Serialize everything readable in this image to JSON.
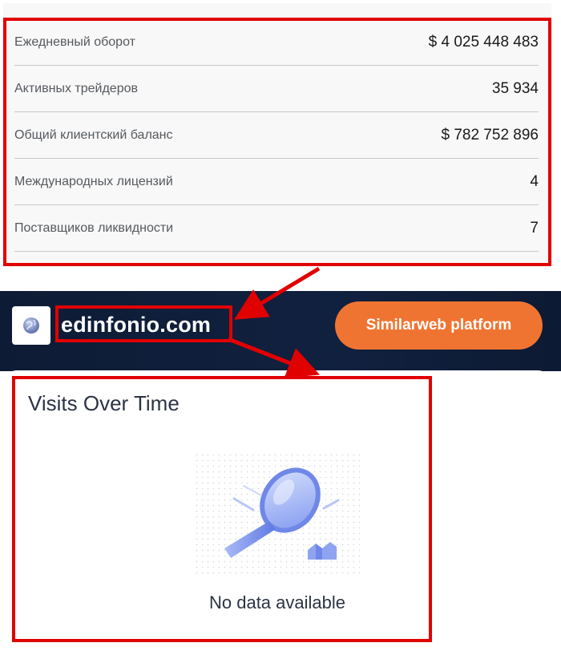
{
  "stats": [
    {
      "label": "Ежедневный оборот",
      "value": "$ 4 025 448 483"
    },
    {
      "label": "Активных трейдеров",
      "value": "35 934"
    },
    {
      "label": "Общий клиентский баланс",
      "value": "$ 782 752 896"
    },
    {
      "label": "Международных лицензий",
      "value": "4"
    },
    {
      "label": "Поставщиков ликвидности",
      "value": "7"
    }
  ],
  "header": {
    "domain": "edinfonio.com",
    "platform_button": "Similarweb platform",
    "site_icon": "globe-icon"
  },
  "card": {
    "title": "Visits Over Time",
    "empty_message": "No data available",
    "illustration_icon": "magnifier-icon"
  },
  "colors": {
    "annotation": "#e10000",
    "header_bg": "#0e1b35",
    "button": "#f07431",
    "illustration": "#8aa2f0"
  }
}
